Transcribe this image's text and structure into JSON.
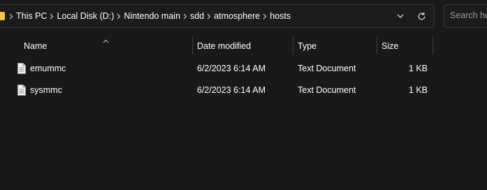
{
  "address": {
    "breadcrumbs": [
      "This PC",
      "Local Disk (D:)",
      "Nintendo main",
      "sdd",
      "atmosphere",
      "hosts"
    ],
    "folder_icon": "folder-icon",
    "dropdown_icon": "chevron-down-icon",
    "refresh_icon": "refresh-icon"
  },
  "search": {
    "placeholder": "Search hosts"
  },
  "columns": {
    "name": "Name",
    "date_modified": "Date modified",
    "type": "Type",
    "size": "Size",
    "sort_icon": "sort-up-icon"
  },
  "files": [
    {
      "name": "emummc",
      "date_modified": "6/2/2023 6:14 AM",
      "type": "Text Document",
      "size": "1 KB",
      "icon": "text-file-icon"
    },
    {
      "name": "sysmmc",
      "date_modified": "6/2/2023 6:14 AM",
      "type": "Text Document",
      "size": "1 KB",
      "icon": "text-file-icon"
    }
  ],
  "colors": {
    "background": "#191919",
    "text": "#ffffff",
    "folder": "#f5c542"
  }
}
